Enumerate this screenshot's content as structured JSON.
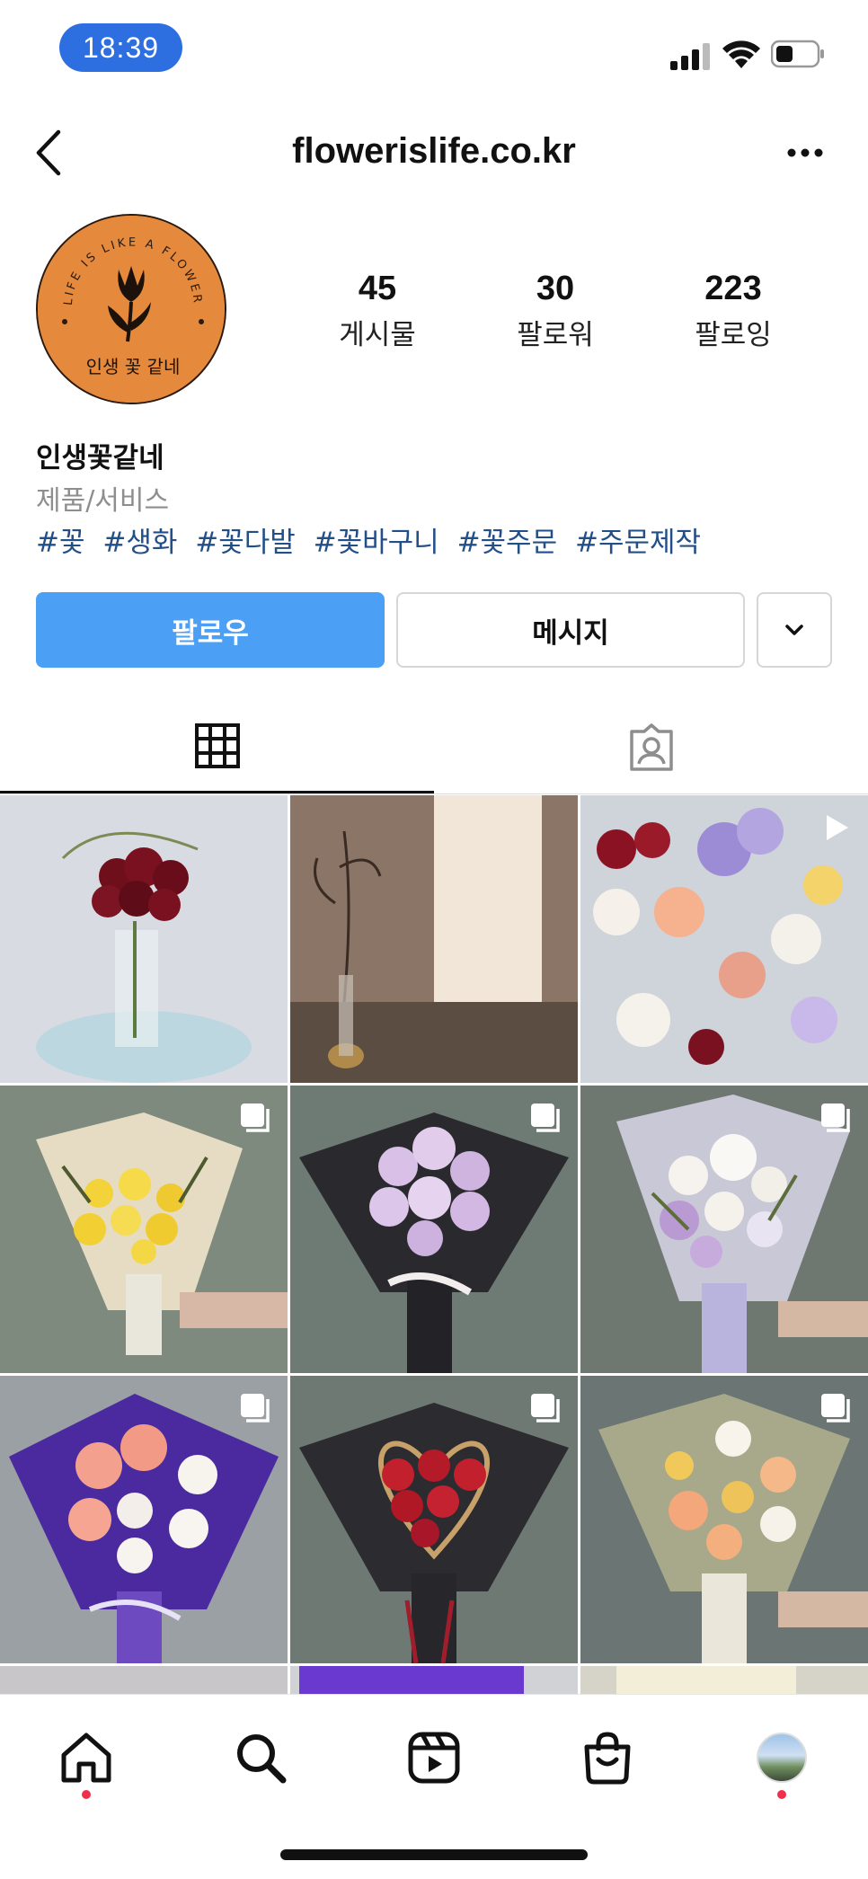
{
  "status_bar": {
    "time": "18:39"
  },
  "header": {
    "username": "flowerislife.co.kr"
  },
  "profile": {
    "avatar_ring_text": "LIFE IS LIKE A FLOWER",
    "avatar_bottom_text": "인생 꽃 같네",
    "stats": [
      {
        "value": "45",
        "label": "게시물"
      },
      {
        "value": "30",
        "label": "팔로워"
      },
      {
        "value": "223",
        "label": "팔로잉"
      }
    ],
    "name": "인생꽃같네",
    "category": "제품/서비스",
    "hashtags": [
      "#꽃",
      "#생화",
      "#꽃다발",
      "#꽃바구니",
      "#꽃주문",
      "#주문제작"
    ]
  },
  "actions": {
    "follow_label": "팔로우",
    "message_label": "메시지"
  },
  "tabs": [
    {
      "icon": "grid-icon",
      "active": true
    },
    {
      "icon": "tagged-icon",
      "active": false
    }
  ],
  "posts": [
    {
      "type": "photo",
      "subject": "red roses in glass vase",
      "badge": "none"
    },
    {
      "type": "photo",
      "subject": "dried flowers and paper lamp",
      "badge": "none"
    },
    {
      "type": "reel",
      "subject": "mixed spring flowers",
      "badge": "play-icon"
    },
    {
      "type": "carousel",
      "subject": "yellow rose bouquet",
      "badge": "carousel-icon"
    },
    {
      "type": "carousel",
      "subject": "lilac stock bouquet in black wrap",
      "badge": "carousel-icon"
    },
    {
      "type": "carousel",
      "subject": "white and lavender bouquet",
      "badge": "carousel-icon"
    },
    {
      "type": "carousel",
      "subject": "pink gerbera bouquet in purple wrap",
      "badge": "carousel-icon"
    },
    {
      "type": "carousel",
      "subject": "red roses heart bouquet",
      "badge": "carousel-icon"
    },
    {
      "type": "carousel",
      "subject": "peach gerbera and tulip bouquet",
      "badge": "carousel-icon"
    }
  ],
  "bottom_nav": [
    {
      "icon": "home-icon",
      "notify": true
    },
    {
      "icon": "search-icon",
      "notify": false
    },
    {
      "icon": "reels-icon",
      "notify": false
    },
    {
      "icon": "shop-icon",
      "notify": false
    },
    {
      "icon": "profile-avatar",
      "notify": true
    }
  ],
  "colors": {
    "accent": "#4b9ff5",
    "hashtag": "#224f87",
    "avatar_bg": "#e58a3c",
    "notify_dot": "#f0304a",
    "time_pill": "#2d6fe0"
  }
}
